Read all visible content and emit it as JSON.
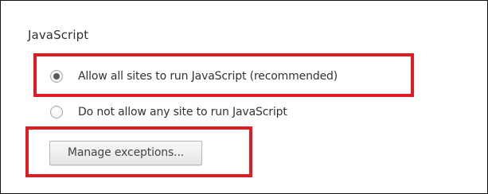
{
  "section": {
    "title": "JavaScript"
  },
  "options": [
    {
      "label": "Allow all sites to run JavaScript (recommended)",
      "selected": true
    },
    {
      "label": "Do not allow any site to run JavaScript",
      "selected": false
    }
  ],
  "buttons": {
    "manage_exceptions": "Manage exceptions..."
  },
  "colors": {
    "highlight": "#e11b22",
    "radio_dot": "#5b5b5b"
  }
}
